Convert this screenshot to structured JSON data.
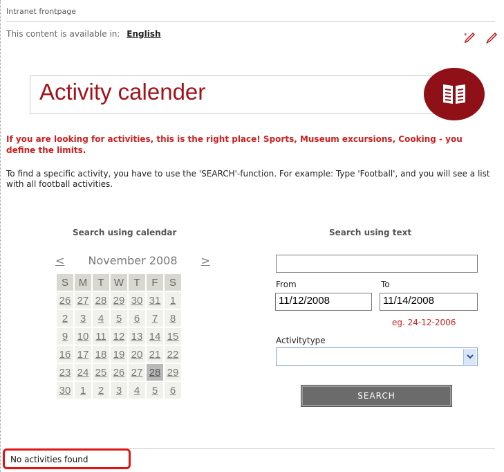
{
  "breadcrumb": "Intranet frontpage",
  "language": {
    "prefix": "This content is available in:",
    "link": "English"
  },
  "edit_icons": [
    "new-item-icon",
    "edit-pencil-icon"
  ],
  "page_title": "Activity calender",
  "title_icon": "book-icon",
  "intro_highlight": "If you are looking for activities, this is the right place! Sports, Museum excursions, Cooking - you define the limits.",
  "intro_text": "To find a specific activity, you have to use the 'SEARCH'-function. For example: Type 'Football', and you will see a list with all football activities.",
  "calendar": {
    "heading": "Search using calendar",
    "prev": "<",
    "next": ">",
    "month": "November 2008",
    "weekdays": [
      "S",
      "M",
      "T",
      "W",
      "T",
      "F",
      "S"
    ],
    "weeks": [
      [
        "26",
        "27",
        "28",
        "29",
        "30",
        "31",
        "1"
      ],
      [
        "2",
        "3",
        "4",
        "5",
        "6",
        "7",
        "8"
      ],
      [
        "9",
        "10",
        "11",
        "12",
        "13",
        "14",
        "15"
      ],
      [
        "16",
        "17",
        "18",
        "19",
        "20",
        "21",
        "22"
      ],
      [
        "23",
        "24",
        "25",
        "26",
        "27",
        "28",
        "29"
      ],
      [
        "30",
        "1",
        "2",
        "3",
        "4",
        "5",
        "6"
      ]
    ],
    "selected": "28"
  },
  "text_search": {
    "heading": "Search using text",
    "query_value": "",
    "from_label": "From",
    "from_value": "11/12/2008",
    "to_label": "To",
    "to_value": "11/14/2008",
    "date_hint": "eg. 24-12-2006",
    "activitytype_label": "Activitytype",
    "activitytype_value": "",
    "search_button": "SEARCH"
  },
  "results_message": "No activities found",
  "colors": {
    "accent": "#a3121a",
    "highlight": "#cc2020",
    "badge": "#8f1016",
    "callout": "#e01414"
  }
}
